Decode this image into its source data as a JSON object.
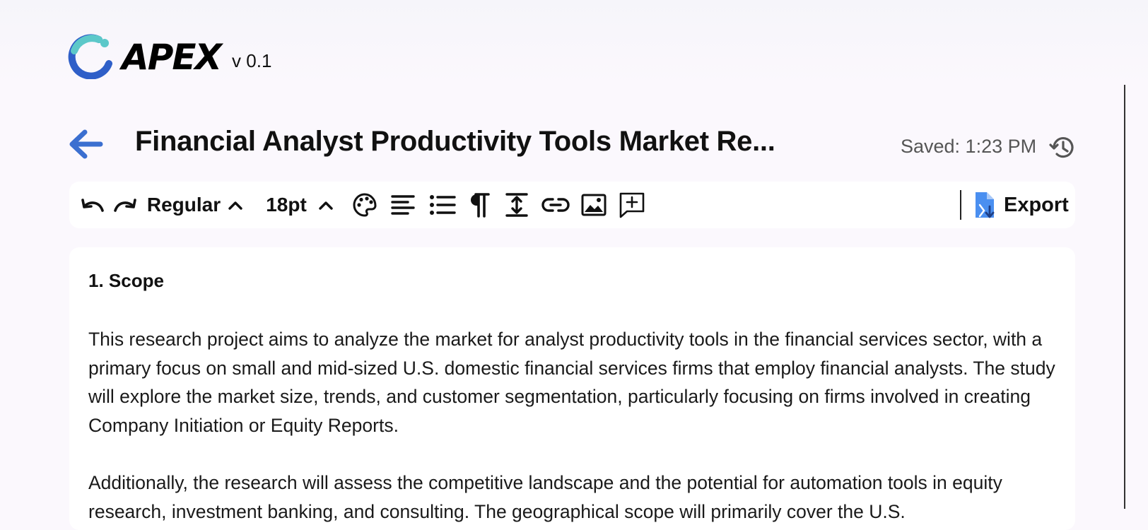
{
  "app": {
    "brand": "APEX",
    "version": "v 0.1"
  },
  "header": {
    "title": "Financial Analyst Productivity Tools Market Re...",
    "saved_status": "Saved: 1:23 PM"
  },
  "toolbar": {
    "font_style": "Regular",
    "font_size": "18pt",
    "export_label": "Export",
    "icons": [
      "undo-icon",
      "redo-icon",
      "chevron-up-icon",
      "palette-icon",
      "align-left-icon",
      "bulleted-list-icon",
      "paragraph-icon",
      "line-spacing-icon",
      "link-icon",
      "image-icon",
      "add-comment-icon",
      "export-file-icon"
    ]
  },
  "document": {
    "heading": "1. Scope",
    "paragraphs": [
      "This research project aims to analyze the market for analyst productivity tools in the financial services sector, with a primary focus on small and mid-sized U.S. domestic financial services firms that employ financial analysts. The study will explore the market size, trends, and customer segmentation, particularly focusing on firms involved in creating Company Initiation or Equity Reports.",
      "Additionally, the research will assess the competitive landscape and the potential for automation tools in equity research, investment banking, and consulting. The geographical scope will primarily cover the U.S."
    ]
  },
  "colors": {
    "brand_teal": "#5cc8c9",
    "brand_blue": "#2f5fc8",
    "back_arrow": "#3b6fd0",
    "export_icon": "#4a8ff0",
    "page_bg": "#fbf8fd"
  }
}
